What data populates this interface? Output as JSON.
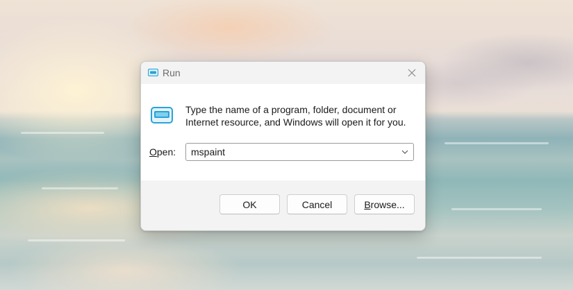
{
  "dialog": {
    "title": "Run",
    "description": "Type the name of a program, folder, document or Internet resource, and Windows will open it for you.",
    "open_label_prefix": "O",
    "open_label_rest": "pen:",
    "open_value": "mspaint",
    "buttons": {
      "ok": "OK",
      "cancel": "Cancel",
      "browse_prefix": "B",
      "browse_rest": "rowse..."
    }
  },
  "icons": {
    "title": "run-icon",
    "close": "close-icon",
    "dropdown": "chevron-down-icon"
  },
  "colors": {
    "icon_accent": "#2aa3d6",
    "titlebar": "#f3f3f3",
    "footer": "#f3f3f3"
  }
}
